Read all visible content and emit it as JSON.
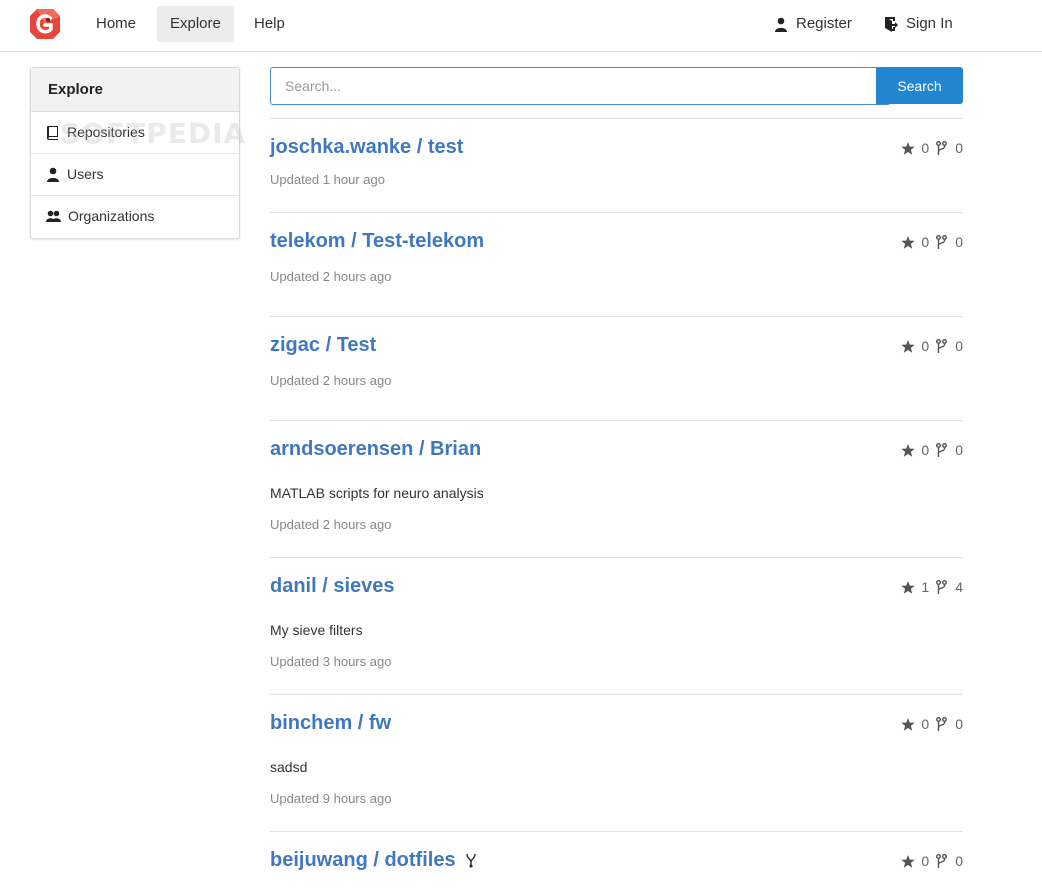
{
  "nav": {
    "home": "Home",
    "explore": "Explore",
    "help": "Help",
    "register": "Register",
    "signin": "Sign In"
  },
  "sidebar": {
    "title": "Explore",
    "items": [
      {
        "label": "Repositories",
        "icon": "book-icon"
      },
      {
        "label": "Users",
        "icon": "person-icon"
      },
      {
        "label": "Organizations",
        "icon": "organization-icon"
      }
    ]
  },
  "watermark": "SOFTPEDIA",
  "search": {
    "placeholder": "Search...",
    "button": "Search"
  },
  "repos": [
    {
      "name": "joschka.wanke / test",
      "description": "",
      "updated": "Updated 1 hour ago",
      "stars": "0",
      "forks": "0"
    },
    {
      "name": "telekom / Test-telekom",
      "description": "",
      "updated": "Updated 2 hours ago",
      "stars": "0",
      "forks": "0"
    },
    {
      "name": "zigac / Test",
      "description": "",
      "updated": "Updated 2 hours ago",
      "stars": "0",
      "forks": "0"
    },
    {
      "name": "arndsoerensen / Brian",
      "description": "MATLAB scripts for neuro analysis",
      "updated": "Updated 2 hours ago",
      "stars": "0",
      "forks": "0"
    },
    {
      "name": "danil / sieves",
      "description": "My sieve filters",
      "updated": "Updated 3 hours ago",
      "stars": "1",
      "forks": "4"
    },
    {
      "name": "binchem / fw",
      "description": "sadsd",
      "updated": "Updated 9 hours ago",
      "stars": "0",
      "forks": "0"
    },
    {
      "name": "beijuwang / dotfiles",
      "description": "",
      "updated": "",
      "stars": "0",
      "forks": "0",
      "mirror": true
    }
  ],
  "colors": {
    "link": "#4078c0",
    "accent": "#2185d0",
    "logo": "#e8453c"
  }
}
